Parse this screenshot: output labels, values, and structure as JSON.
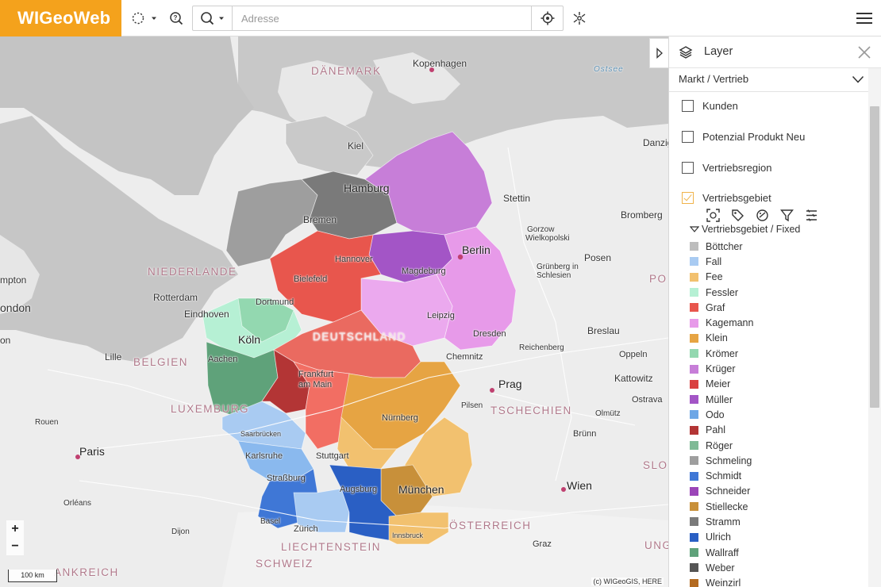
{
  "app": {
    "logo": "WIGeoWeb"
  },
  "toolbar": {
    "search_placeholder": "Adresse",
    "icons": [
      "lasso-select-icon",
      "chevron-down-icon",
      "help-search-icon",
      "search-icon",
      "locate-icon",
      "route-tool-icon",
      "menu-icon"
    ]
  },
  "map": {
    "labels": {
      "kopenhagen": "Kopenhagen",
      "daenemark": "DÄNEMARK",
      "ostsee": "Ostsee",
      "kiel": "Kiel",
      "danzig": "Danzig",
      "hamburg": "Hamburg",
      "bremen": "Bremen",
      "stettin": "Stettin",
      "bromberg": "Bromberg",
      "gorzow": "Gorzow",
      "wielkopolski": "Wielkopolski",
      "hannover": "Hannover",
      "posen": "Posen",
      "berlin": "Berlin",
      "niederlande": "NIEDERLANDE",
      "bielefeld": "Bielefeld",
      "magdeburg": "Magdeburg",
      "gruenberg": "Grünberg in",
      "schlesien": "Schlesien",
      "rotterdam": "Rotterdam",
      "dortmund": "Dortmund",
      "mpton": "mpton",
      "ondon": "ondon",
      "eindhoven": "Eindhoven",
      "leipzig": "Leipzig",
      "breslau": "Breslau",
      "koeln": "Köln",
      "deutschland": "DEUTSCHLAND",
      "dresden": "Dresden",
      "on": "on",
      "aachen": "Aachen",
      "reichenberg": "Reichenberg",
      "lille": "Lille",
      "belgien": "BELGIEN",
      "chemnitz": "Chemnitz",
      "oppeln": "Oppeln",
      "frankfurt1": "Frankfurt",
      "frankfurt2": "am Main",
      "kattowitz": "Kattowitz",
      "prag": "Prag",
      "luxemburg": "LUXEMBURG",
      "tschechien": "TSCHECHIEN",
      "pilsen": "Pilsen",
      "olmuetz": "Olmütz",
      "ostrava": "Ostrava",
      "rouen": "Rouen",
      "nuernberg": "Nürnberg",
      "saarbruecken": "Saarbrücken",
      "bruenn": "Brünn",
      "paris": "Paris",
      "karlsruhe": "Karlsruhe",
      "stuttgart": "Stuttgart",
      "slo": "SLO",
      "strassburg": "Straßburg",
      "augsburg": "Augsburg",
      "muenchen": "München",
      "wien": "Wien",
      "orleans": "Orléans",
      "basel": "Basel",
      "zuerich": "Zürich",
      "oesterreich": "ÖSTERREICH",
      "dijon": "Dijon",
      "innsbruck": "Innsbruck",
      "liechtenstein": "LIECHTENSTEIN",
      "graz": "Graz",
      "ung": "UNG",
      "ankreich": "ANKREICH",
      "schweiz": "SCHWEIZ",
      "po": "PO"
    },
    "zoom_in": "+",
    "zoom_out": "−",
    "scale": "100 km",
    "copyright": "(c) WIGeoGIS, HERE"
  },
  "panel": {
    "title": "Layer",
    "dropdown_value": "Markt / Vertrieb",
    "layers": [
      {
        "label": "Kunden",
        "checked": false
      },
      {
        "label": "Potenzial Produkt Neu",
        "checked": false
      },
      {
        "label": "Vertriebsregion",
        "checked": false
      },
      {
        "label": "Vertriebsgebiet",
        "checked": true
      }
    ],
    "layer_tools": [
      "zoom-extent-icon",
      "label-tag-icon",
      "style-icon",
      "filter-icon",
      "legend-settings-icon"
    ],
    "sublayer_title": "Vertriebsgebiet / Fixed",
    "legend": [
      {
        "label": "Böttcher",
        "color": "#bdbdbd"
      },
      {
        "label": "Fall",
        "color": "#a9cbf2"
      },
      {
        "label": "Fee",
        "color": "#f2c16f"
      },
      {
        "label": "Fessler",
        "color": "#b6f0d4"
      },
      {
        "label": "Graf",
        "color": "#e8564d"
      },
      {
        "label": "Kagemann",
        "color": "#e79ae9"
      },
      {
        "label": "Klein",
        "color": "#e6a443"
      },
      {
        "label": "Krömer",
        "color": "#93d8b0"
      },
      {
        "label": "Krüger",
        "color": "#c77ed8"
      },
      {
        "label": "Meier",
        "color": "#d94040"
      },
      {
        "label": "Müller",
        "color": "#a355c6"
      },
      {
        "label": "Odo",
        "color": "#6ea7e6"
      },
      {
        "label": "Pahl",
        "color": "#b33535"
      },
      {
        "label": "Röger",
        "color": "#7fba96"
      },
      {
        "label": "Schmeling",
        "color": "#9e9e9e"
      },
      {
        "label": "Schmidt",
        "color": "#3f77d6"
      },
      {
        "label": "Schneider",
        "color": "#9b45b8"
      },
      {
        "label": "Stiellecke",
        "color": "#c8903a"
      },
      {
        "label": "Stramm",
        "color": "#7a7a7a"
      },
      {
        "label": "Ulrich",
        "color": "#2a5fc4"
      },
      {
        "label": "Wallraff",
        "color": "#5fa27a"
      },
      {
        "label": "Weber",
        "color": "#555555"
      },
      {
        "label": "Weinzirl",
        "color": "#b36a20"
      }
    ]
  }
}
